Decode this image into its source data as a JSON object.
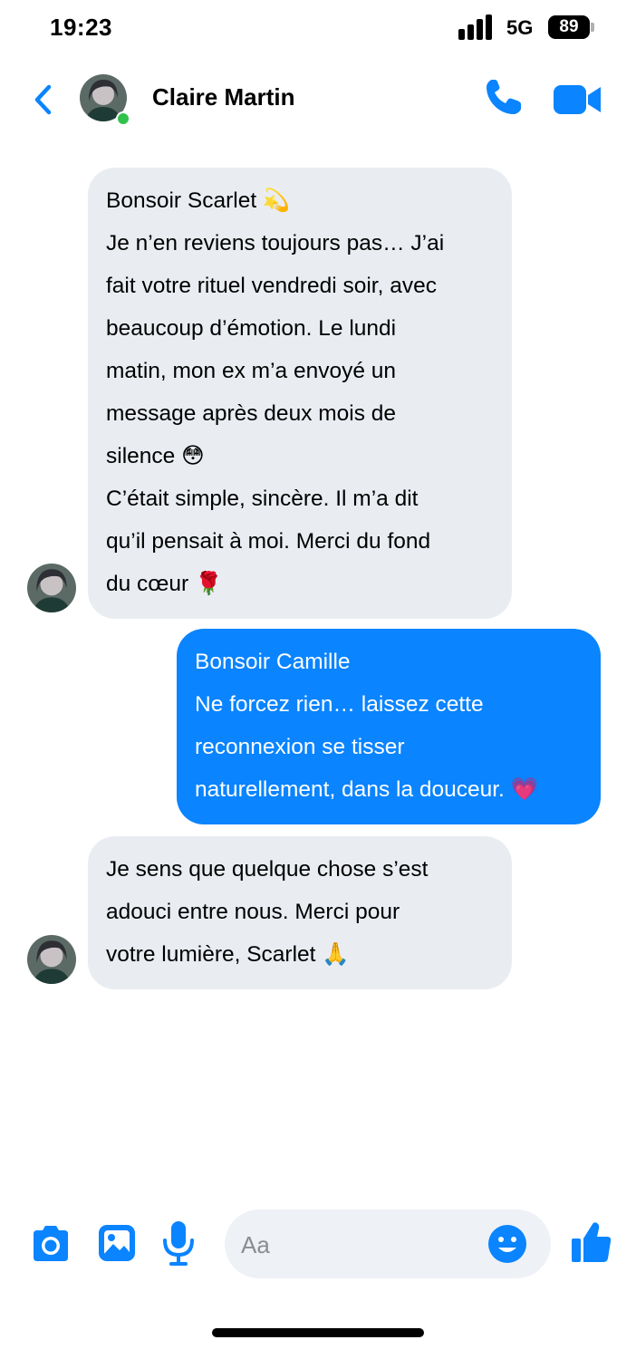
{
  "status_bar": {
    "time": "19:23",
    "network": "5G",
    "battery": "89"
  },
  "header": {
    "contact_name": "Claire Martin",
    "online": true,
    "icons": [
      "back-chevron-icon",
      "phone-icon",
      "video-camera-icon"
    ]
  },
  "messages": [
    {
      "direction": "incoming",
      "lines": [
        "Bonsoir Scarlet 💫",
        "Je n’en reviens toujours pas… J’ai",
        "fait votre rituel vendredi soir, avec",
        "beaucoup d’émotion. Le lundi",
        "matin, mon ex m’a envoyé un",
        "message après deux mois de",
        "silence 😳",
        "C’était simple, sincère. Il m’a dit",
        "qu’il pensait à moi. Merci du fond",
        "du cœur 🌹"
      ]
    },
    {
      "direction": "outgoing",
      "lines": [
        "Bonsoir Camille",
        "Ne forcez rien… laissez cette",
        "reconnexion se tisser",
        "naturellement, dans la douceur. 💗"
      ]
    },
    {
      "direction": "incoming",
      "lines": [
        "Je sens que quelque chose s’est",
        "adouci entre nous. Merci pour",
        "votre lumière, Scarlet 🙏"
      ]
    }
  ],
  "composer": {
    "placeholder": "Aa",
    "value": "",
    "icons": [
      "camera-icon",
      "photo-icon",
      "microphone-icon",
      "emoji-icon",
      "thumbs-up-icon"
    ]
  },
  "colors": {
    "accent": "#0a84ff",
    "incoming_bubble": "#e9edf2",
    "online": "#31c24d"
  }
}
